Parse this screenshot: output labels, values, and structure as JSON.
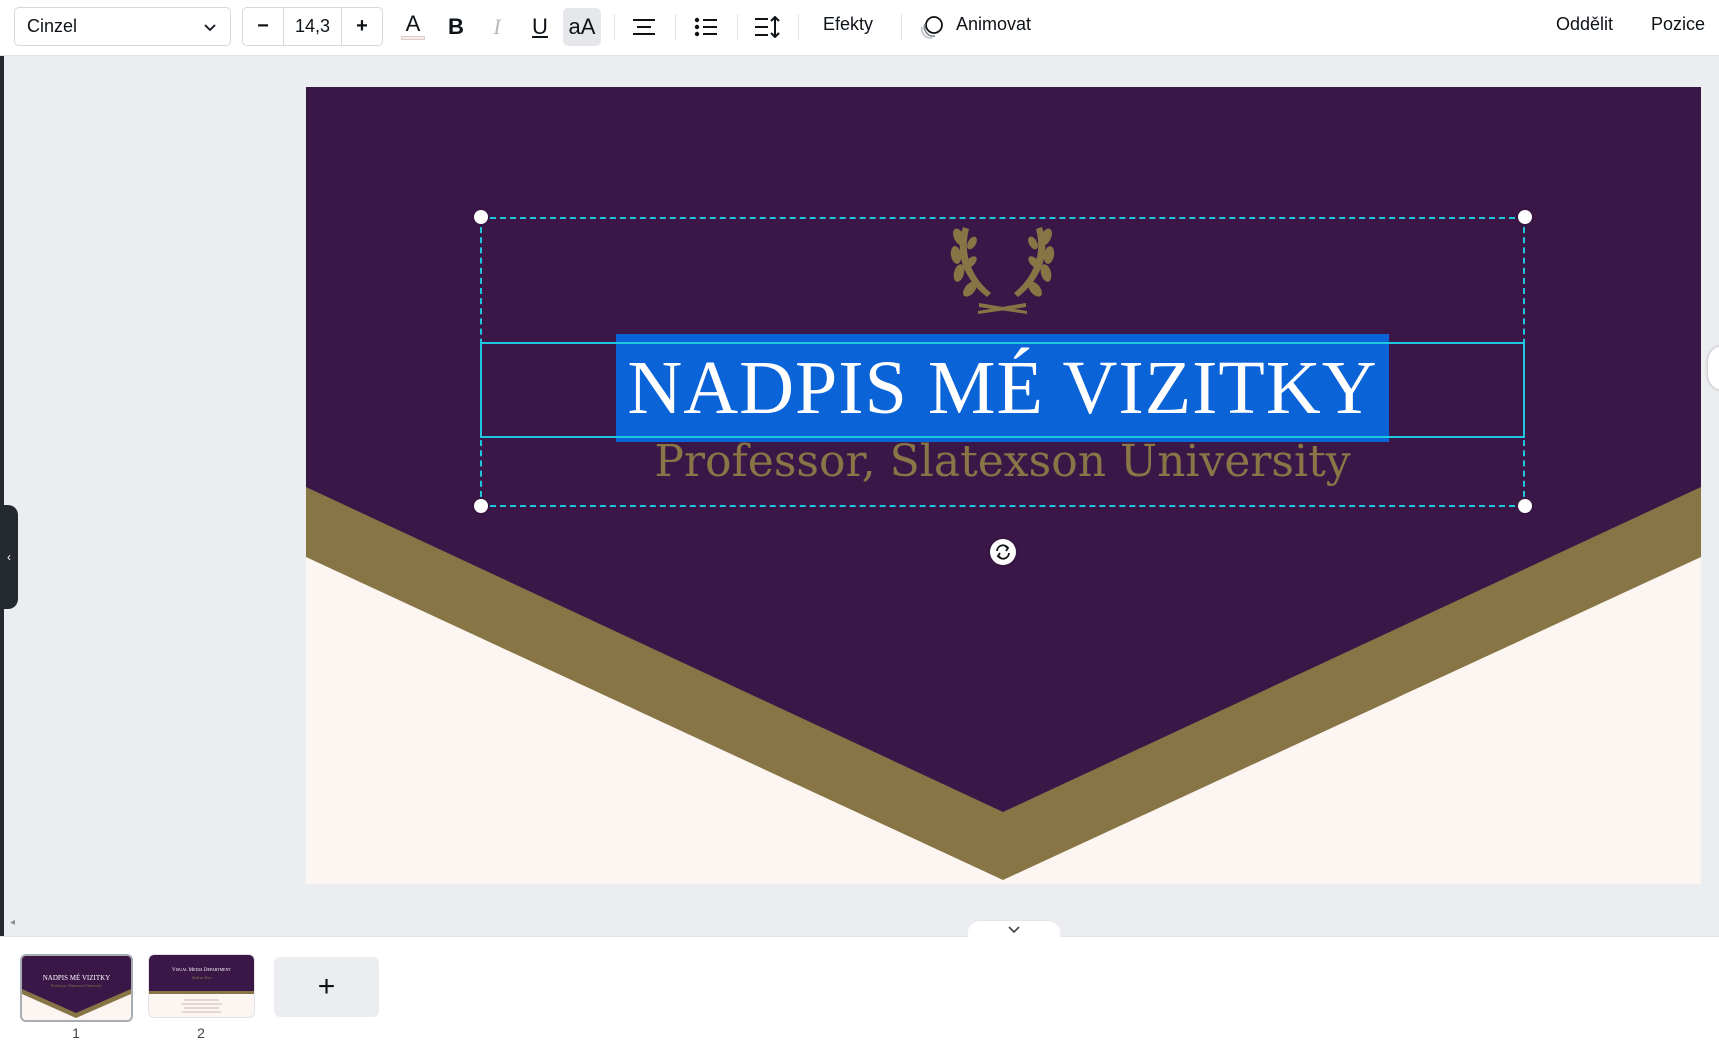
{
  "toolbar": {
    "font_name": "Cinzel",
    "font_size_decrease": "−",
    "font_size": "14,3",
    "font_size_increase": "+",
    "text_color_glyph": "A",
    "bold_glyph": "B",
    "italic_glyph": "I",
    "underline_glyph": "U",
    "case_glyph": "aA",
    "effects_label": "Efekty",
    "animate_label": "Animovat",
    "ungroup_label": "Oddělit",
    "position_label": "Pozice"
  },
  "design": {
    "title": "NADPIS MÉ VIZITKY",
    "subtitle": "Professor, Slatexson University",
    "colors": {
      "purple": "#3b1748",
      "gold": "#877546",
      "cream": "#fdf5f1",
      "selection": "#0b63d8",
      "guide": "#1fc6de"
    }
  },
  "pages": {
    "thumbs": [
      {
        "number": "1",
        "title": "NADPIS MÉ VIZITKY",
        "subtitle": "Professor, Slatexson University"
      },
      {
        "number": "2",
        "title": "Visual Media Department",
        "subtitle": "Andrea Kim"
      }
    ],
    "add_label": "+"
  },
  "icons": {
    "font_dropdown": "chevron-down-icon",
    "text_color": "text-color-icon",
    "align": "align-center-icon",
    "list": "bullet-list-icon",
    "spacing": "line-spacing-icon",
    "animate": "animate-icon",
    "rotate": "rotate-icon",
    "laurel": "laurel-wreath-icon"
  }
}
